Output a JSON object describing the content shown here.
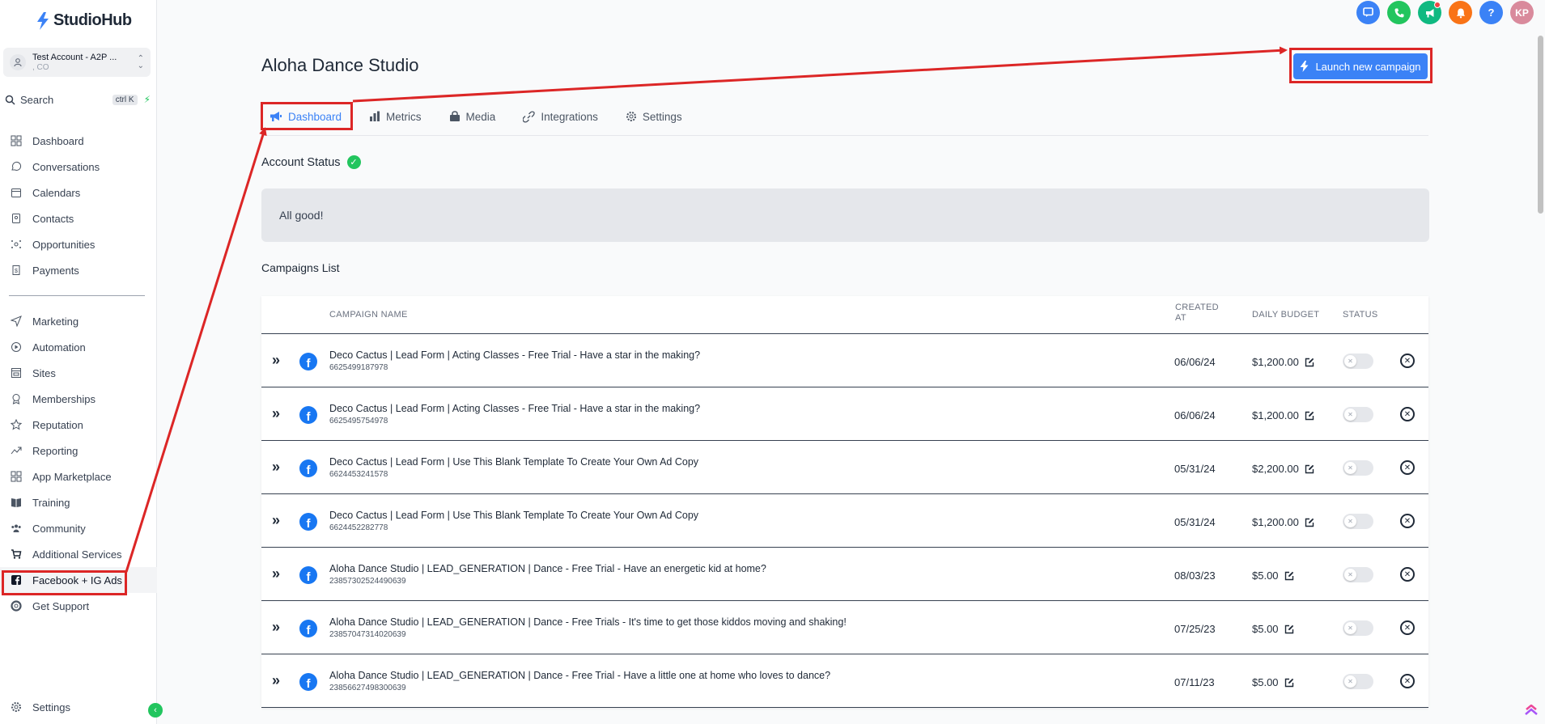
{
  "app": {
    "name": "StudioHub"
  },
  "account": {
    "name": "Test Account - A2P ...",
    "location": ", CO"
  },
  "search": {
    "label": "Search",
    "shortcut": "ctrl K"
  },
  "sidebar": {
    "items": [
      {
        "label": "Dashboard",
        "icon": "grid-icon"
      },
      {
        "label": "Conversations",
        "icon": "chat-icon"
      },
      {
        "label": "Calendars",
        "icon": "calendar-icon"
      },
      {
        "label": "Contacts",
        "icon": "contacts-icon"
      },
      {
        "label": "Opportunities",
        "icon": "opportunities-icon"
      },
      {
        "label": "Payments",
        "icon": "payments-icon"
      }
    ],
    "items2": [
      {
        "label": "Marketing",
        "icon": "send-icon"
      },
      {
        "label": "Automation",
        "icon": "automation-icon"
      },
      {
        "label": "Sites",
        "icon": "sites-icon"
      },
      {
        "label": "Memberships",
        "icon": "membership-icon"
      },
      {
        "label": "Reputation",
        "icon": "star-icon"
      },
      {
        "label": "Reporting",
        "icon": "trend-icon"
      },
      {
        "label": "App Marketplace",
        "icon": "apps-icon"
      },
      {
        "label": "Training",
        "icon": "book-icon"
      },
      {
        "label": "Community",
        "icon": "community-icon"
      },
      {
        "label": "Additional Services",
        "icon": "cart-icon"
      },
      {
        "label": "Facebook + IG Ads",
        "icon": "facebook-icon"
      },
      {
        "label": "Get Support",
        "icon": "support-icon"
      }
    ],
    "settings_label": "Settings"
  },
  "topbar": {
    "avatar_initials": "KP",
    "help_label": "?",
    "colors": {
      "chat": "#3b82f6",
      "phone": "#22c55e",
      "announce": "#10b981",
      "bell": "#f97316",
      "help": "#3b82f6",
      "avatar": "#d98a9c"
    }
  },
  "page": {
    "title": "Aloha Dance Studio",
    "launch_label": "Launch new campaign",
    "tabs": [
      {
        "label": "Dashboard",
        "icon": "megaphone-icon"
      },
      {
        "label": "Metrics",
        "icon": "bar-chart-icon"
      },
      {
        "label": "Media",
        "icon": "media-icon"
      },
      {
        "label": "Integrations",
        "icon": "link-icon"
      },
      {
        "label": "Settings",
        "icon": "gear-icon"
      }
    ],
    "account_status_label": "Account Status",
    "status_message": "All good!",
    "campaigns_label": "Campaigns List"
  },
  "table": {
    "headers": {
      "name": "CAMPAIGN NAME",
      "created_1": "CREATED",
      "created_2": "AT",
      "budget": "DAILY BUDGET",
      "status": "STATUS"
    },
    "rows": [
      {
        "name": "Deco Cactus | Lead Form | Acting Classes - Free Trial - Have a star in the making?",
        "id": "6625499187978",
        "created": "06/06/24",
        "budget": "$1,200.00",
        "active": false
      },
      {
        "name": "Deco Cactus | Lead Form | Acting Classes - Free Trial - Have a star in the making?",
        "id": "6625495754978",
        "created": "06/06/24",
        "budget": "$1,200.00",
        "active": false
      },
      {
        "name": "Deco Cactus | Lead Form | Use This Blank Template To Create Your Own Ad Copy",
        "id": "6624453241578",
        "created": "05/31/24",
        "budget": "$2,200.00",
        "active": false
      },
      {
        "name": "Deco Cactus | Lead Form | Use This Blank Template To Create Your Own Ad Copy",
        "id": "6624452282778",
        "created": "05/31/24",
        "budget": "$1,200.00",
        "active": false
      },
      {
        "name": "Aloha Dance Studio | LEAD_GENERATION | Dance - Free Trial - Have an energetic kid at home?",
        "id": "23857302524490639",
        "created": "08/03/23",
        "budget": "$5.00",
        "active": false
      },
      {
        "name": "Aloha Dance Studio | LEAD_GENERATION | Dance - Free Trials - It's time to get those kiddos moving and shaking!",
        "id": "23857047314020639",
        "created": "07/25/23",
        "budget": "$5.00",
        "active": false
      },
      {
        "name": "Aloha Dance Studio | LEAD_GENERATION | Dance - Free Trial - Have a little one at home who loves to dance?",
        "id": "23856627498300639",
        "created": "07/11/23",
        "budget": "$5.00",
        "active": false
      }
    ]
  },
  "annotation": {
    "highlight_color": "#dc2626"
  }
}
